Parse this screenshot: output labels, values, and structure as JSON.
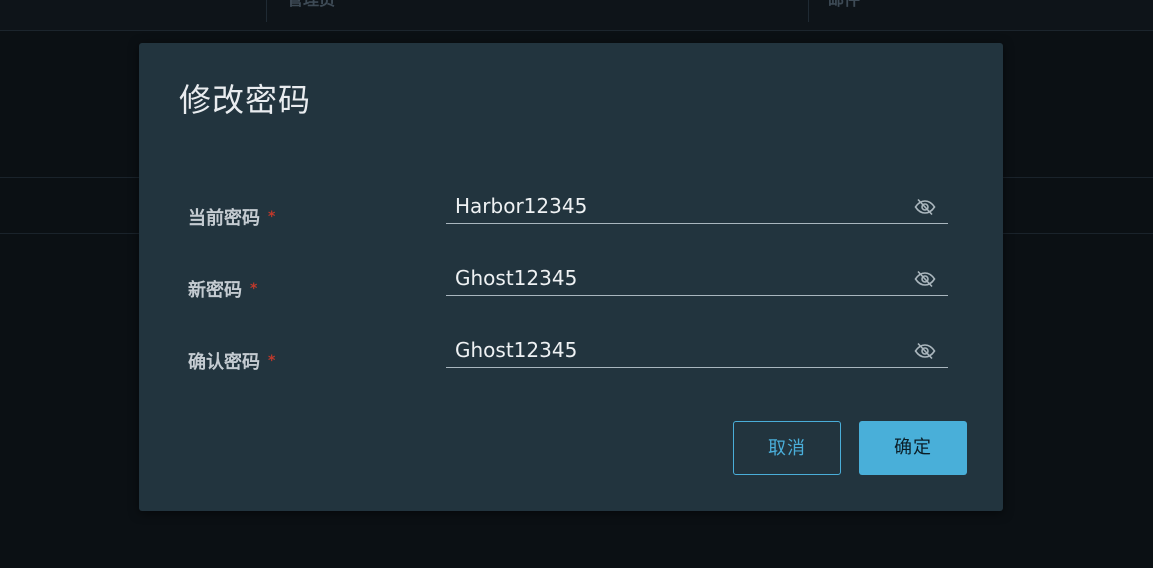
{
  "background": {
    "header_col1": "管理员",
    "header_col2": "邮件"
  },
  "dialog": {
    "title": "修改密码",
    "fields": [
      {
        "label": "当前密码",
        "required_mark": "*",
        "value": "Harbor12345",
        "toggle_icon": "eye-slash-icon"
      },
      {
        "label": "新密码",
        "required_mark": "*",
        "value": "Ghost12345",
        "toggle_icon": "eye-slash-icon"
      },
      {
        "label": "确认密码",
        "required_mark": "*",
        "value": "Ghost12345",
        "toggle_icon": "eye-slash-icon"
      }
    ],
    "cancel_label": "取消",
    "ok_label": "确定"
  },
  "colors": {
    "page_background": "#0b1014",
    "dialog_background": "#22343e",
    "accent": "#49afd9",
    "required": "#c0392b"
  }
}
